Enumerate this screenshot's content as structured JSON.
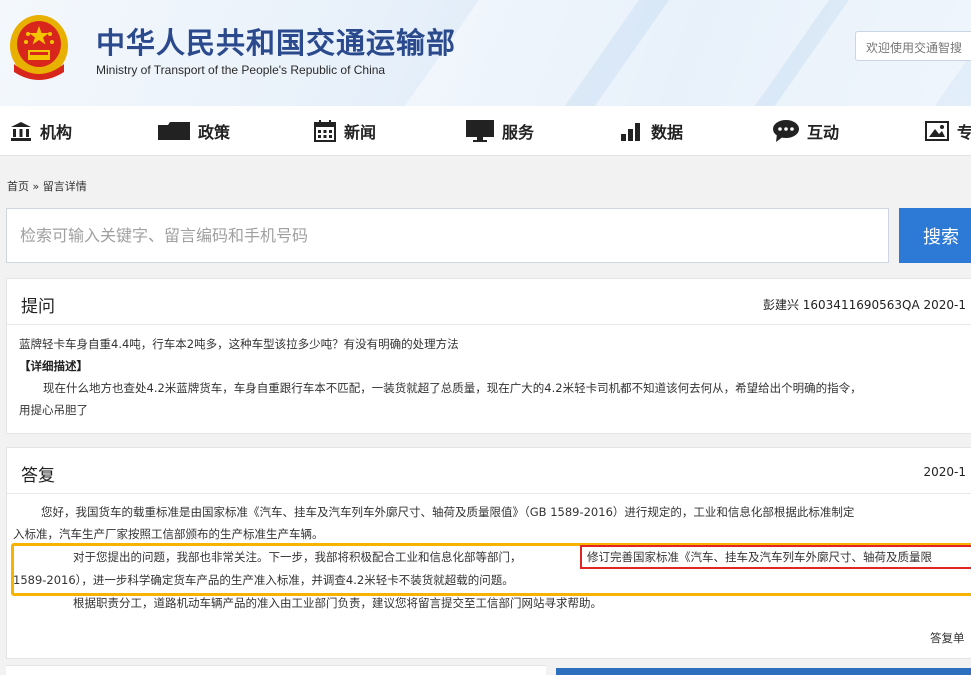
{
  "header": {
    "title": "中华人民共和国交通运输部",
    "subtitle": "Ministry of Transport of the People's Republic of China",
    "welcome_placeholder": "欢迎使用交通智搜"
  },
  "nav": {
    "items": [
      {
        "label": "机构",
        "icon": "building-icon"
      },
      {
        "label": "政策",
        "icon": "folder-icon"
      },
      {
        "label": "新闻",
        "icon": "calendar-icon"
      },
      {
        "label": "服务",
        "icon": "monitor-icon"
      },
      {
        "label": "数据",
        "icon": "bar-chart-icon"
      },
      {
        "label": "互动",
        "icon": "chat-icon"
      },
      {
        "label": "专",
        "icon": "image-icon"
      }
    ]
  },
  "breadcrumb": "首页 » 留言详情",
  "search": {
    "placeholder": "检索可输入关键字、留言编码和手机号码",
    "button_label": "搜索"
  },
  "question": {
    "title": "提问",
    "meta": "彭建兴 1603411690563QA  2020-1",
    "summary": "蓝牌轻卡车身自重4.4吨，行车本2吨多，这种车型该拉多少吨？有没有明确的处理方法",
    "detail_label": "【详细描述】",
    "detail_line1": "现在什么地方也查处4.2米蓝牌货车，车身自重跟行车本不匹配，一装货就超了总质量，现在广大的4.2米轻卡司机都不知道该何去何从，希望给出个明确的指令，",
    "detail_line2": "用提心吊胆了"
  },
  "answer": {
    "title": "答复",
    "date": "2020-1",
    "p1_line1": "您好，我国货车的载重标准是由国家标准《汽车、挂车及汽车列车外廓尺寸、轴荷及质量限值》（GB 1589-2016）进行规定的，工业和信息化部根据此标准制定",
    "p1_line2": "入标准，汽车生产厂家按照工信部颁布的生产标准生产车辆。",
    "p2_line1_a": "对于您提出的问题，我部也非常关注。下一步，我部将积极配合工业和信息化部等部门，",
    "p2_line1_b": "修订完善国家标准《汽车、挂车及汽车列车外廓尺寸、轴荷及质量限",
    "p2_line2": "1589-2016），进一步科学确定货车产品的生产准入标准，并调查4.2米轻卡不装货就超载的问题。",
    "p3": "根据职责分工，道路机动车辆产品的准入由工业部门负责，建议您将留言提交至工信部门网站寻求帮助。",
    "footer": "答复单"
  },
  "colors": {
    "brand_blue": "#2b4a8e",
    "button_blue": "#2d7ad6",
    "highlight_yellow": "#f6b400",
    "highlight_red": "#e22424"
  }
}
